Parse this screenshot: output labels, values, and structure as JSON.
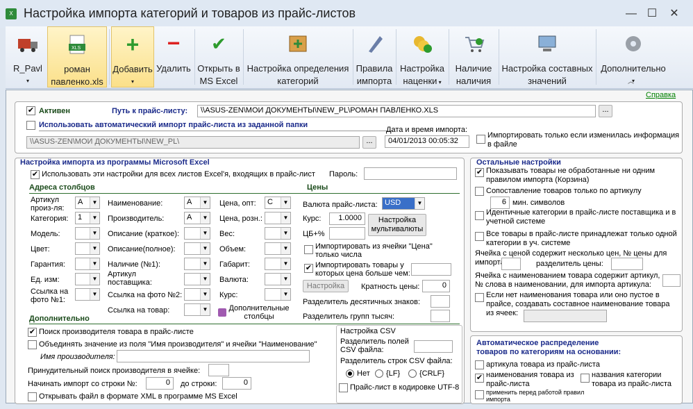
{
  "window": {
    "title": "Настройка импорта категорий и товаров из прайс-листов",
    "min": "—",
    "max": "☐",
    "close": "✕"
  },
  "ribbon": {
    "supplier": "R_Pavl",
    "file": "роман",
    "file2": "павленко.xls",
    "add": "Добавить",
    "remove": "Удалить",
    "open1": "Открыть в",
    "open2": "MS Excel",
    "cat1": "Настройка определения",
    "cat2": "категорий",
    "rules1": "Правила",
    "rules2": "импорта",
    "markup1": "Настройка",
    "markup2": "наценки",
    "avail1": "Наличие",
    "avail2": "наличия",
    "comp1": "Настройка составных",
    "comp2": "значений",
    "extra": "Дополнительно"
  },
  "help": "Справка",
  "top": {
    "active": "Активен",
    "path_label": "Путь к прайс-листу:",
    "path_value": "\\\\ASUS-ZEN\\МОИ ДОКУМЕНТЫ\\NEW_PL\\РОМАН ПАВЛЕНКО.XLS",
    "auto_import": "Использовать автоматический импорт прайс-листа из заданной папки",
    "folder_value": "\\\\ASUS-ZEN\\МОИ ДОКУМЕНТЫ\\NEW_PL\\",
    "dt_label": "Дата и время импорта:",
    "dt_value": "04/01/2013 00:05:32",
    "only_changed": "Импортировать только если изменилась информация в файле"
  },
  "excel": {
    "header": "Настройка импорта из программы Microsoft Excel",
    "all_sheets": "Использовать эти настройки для всех листов Excel'я, входящих в прайс-лист",
    "password": "Пароль:",
    "cols_header": "Адреса столбцов",
    "prices_header": "Цены",
    "article": "Артикул произ-ля:",
    "category": "Категория:",
    "model": "Модель:",
    "color": "Цвет:",
    "warranty": "Гарантия:",
    "unit": "Ед. изм:",
    "photo": "Ссылка на фото №1:",
    "name": "Наименование:",
    "maker": "Производитель:",
    "desc_short": "Описание (краткое):",
    "desc_full": "Описание(полное):",
    "avail": "Наличие (№1):",
    "supplier_art": "Артикул поставщика:",
    "photo2": "Ссылка на фото №2:",
    "product_link": "Ссылка на товар:",
    "price_opt": "Цена, опт:",
    "price_retail": "Цена, розн.:",
    "weight": "Вес:",
    "volume": "Объем:",
    "size": "Габарит:",
    "currency": "Валюта:",
    "rate": "Курс:",
    "extra_cols": "Дополнительные столбцы",
    "v_article": "A",
    "v_category": "1",
    "v_name": "A",
    "v_maker": "A",
    "v_price_opt": "C",
    "price_currency": "Валюта прайс-листа:",
    "currency_val": "USD",
    "rate_label": "Курс:",
    "rate_val": "1.0000",
    "cb_label": "ЦБ+%",
    "multi_currency": "Настройка мультивалюты",
    "numbers_only": "Импортировать из ячейки \"Цена\" только числа",
    "price_gt": "Импортировать товары у которых цена больше чем:",
    "setup": "Настройка",
    "multiplicity": "Кратность цены:",
    "multiplicity_val": "0",
    "dec_sep": "Разделитель десятичных знаков:",
    "group_sep": "Разделитель групп тысяч:"
  },
  "extra": {
    "header": "Дополнительно",
    "search_maker": "Поиск производителя товара в прайс-листе",
    "merge": "Объединять значение из поля \"Имя производителя\" и ячейки \"Наименование\"",
    "maker_name": "Имя производителя:",
    "forced": "Принудительный поиск производителя в ячейке:",
    "start_row": "Начинать импорт со строки №:",
    "start_val": "0",
    "to_row": "до строки:",
    "to_val": "0",
    "xml": "Открывать файл в формате XML в программе MS Excel"
  },
  "csv": {
    "header": "Настройка CSV",
    "field_sep": "Разделитель полей CSV файла:",
    "row_sep": "Разделитель строк CSV файла:",
    "r_none": "Нет",
    "r_lf": "{LF}",
    "r_crlf": "{CRLF}",
    "utf8": "Прайс-лист в кодировке UTF-8"
  },
  "other": {
    "header": "Остальные настройки",
    "basket": "Показывать товары не обработанные ни одним правилом импорта (Корзина)",
    "match_art": "Сопоставление товаров только по артикулу",
    "min_chars_val": "6",
    "min_chars": "мин. символов",
    "same_cat": "Идентичные категории в прайс-листе поставщика и в учетной системе",
    "one_cat": "Все товары в прайс-листе принадлежат только одной категории в уч. системе",
    "multi_price": "Ячейка с ценой содержит несколько цен, № цены для импорта:",
    "price_sep": "разделитель цены:",
    "name_art": "Ячейка с наименованием товара содержит артикул, № слова в наименовании, для импорта артикула:",
    "compose": "Если нет наименования товара или оно пустое в прайсе, создавать составное наименование товара из ячеек:"
  },
  "auto": {
    "header1": "Автоматическое распределение",
    "header2": "товаров по категориям на основании:",
    "by_art": "артикула товара из прайс-листа",
    "by_name": "наименования товара из прайс-листа",
    "by_cat": "названия категории товара из прайс-листа",
    "apply": "применить перед работой правил импорта"
  }
}
